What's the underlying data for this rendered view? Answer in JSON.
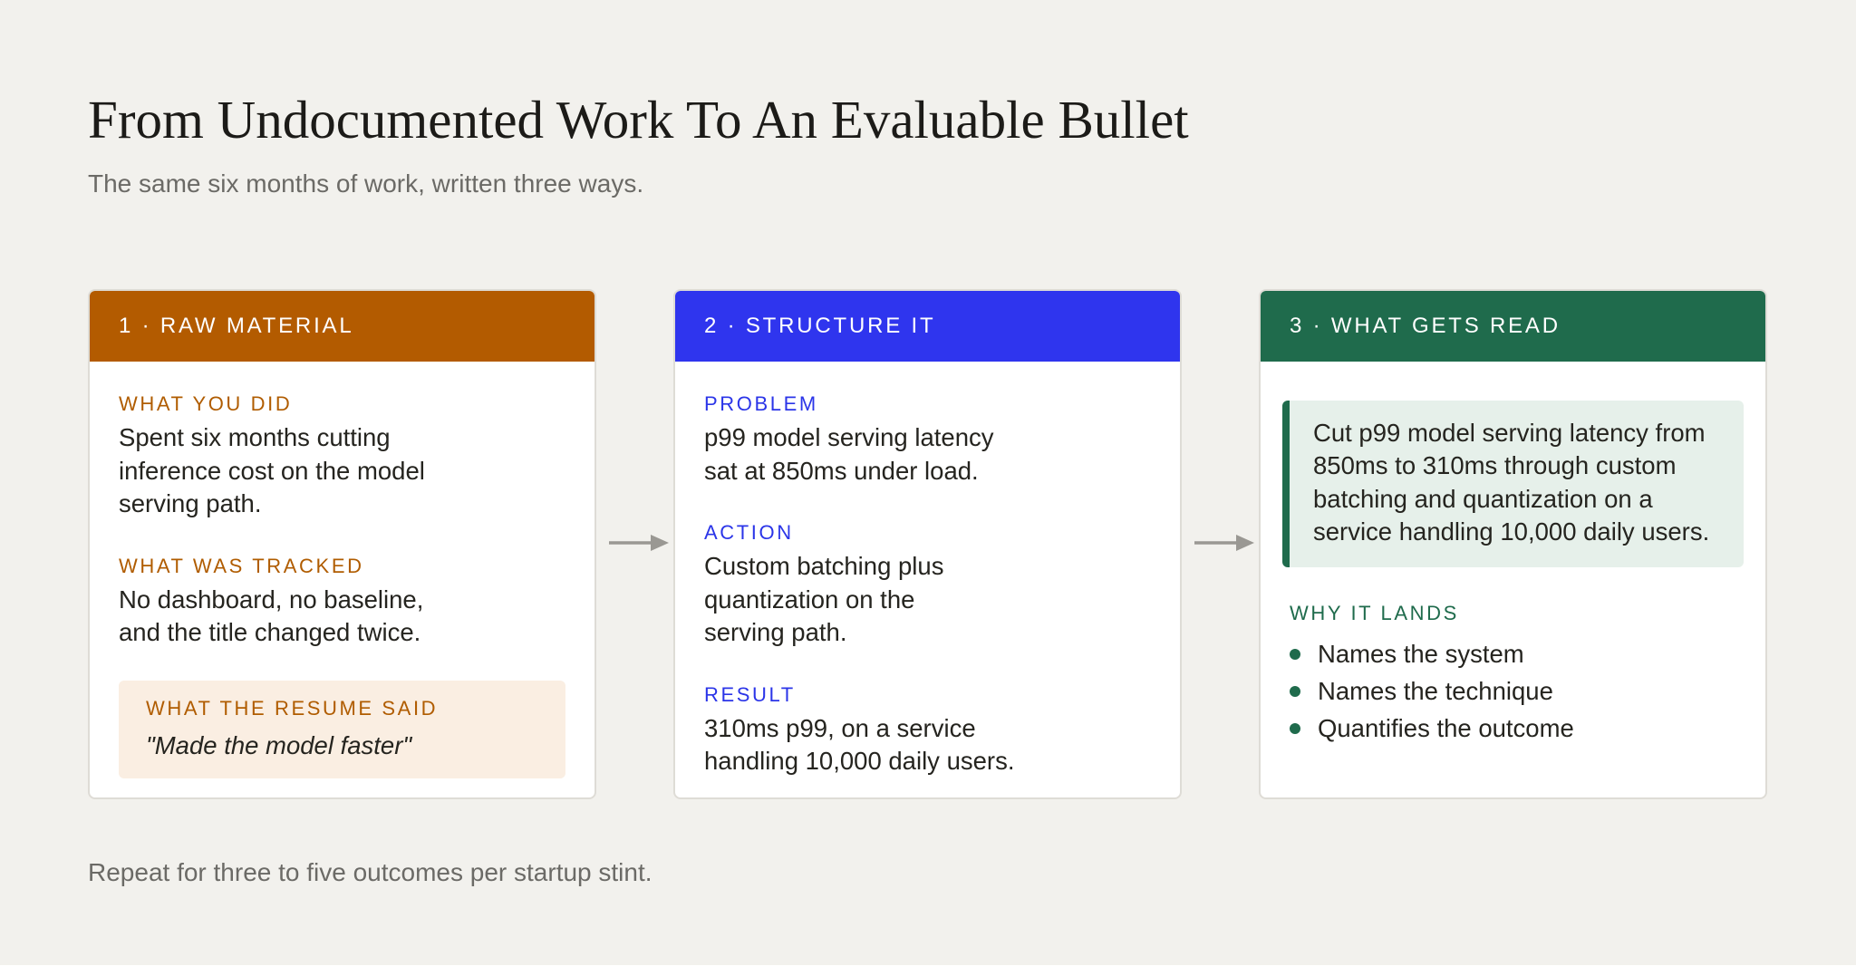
{
  "title": "From Undocumented Work To An Evaluable Bullet",
  "subtitle": "The same six months of work, written three ways.",
  "footer": "Repeat for three to five outcomes per startup stint.",
  "colors": {
    "background": "#f2f1ed",
    "raw": "#b35b00",
    "raw_tint": "#faeee2",
    "structure": "#2f35ee",
    "read": "#1f6b4c",
    "read_tint": "#e6f0ea",
    "arrow": "#9a9893"
  },
  "cards": {
    "raw": {
      "header": "1 · RAW MATERIAL",
      "sections": [
        {
          "label": "WHAT YOU DID",
          "text": "Spent six months cutting inference cost on the model serving path."
        },
        {
          "label": "WHAT WAS TRACKED",
          "text": "No dashboard, no baseline, and the title changed twice."
        }
      ],
      "quote": {
        "label": "WHAT THE RESUME SAID",
        "text": "\"Made the model faster\""
      }
    },
    "structure": {
      "header": "2 · STRUCTURE IT",
      "sections": [
        {
          "label": "PROBLEM",
          "text": "p99 model serving latency sat at 850ms under load."
        },
        {
          "label": "ACTION",
          "text": "Custom batching plus quantization on the serving path."
        },
        {
          "label": "RESULT",
          "text": "310ms p99, on a service handling 10,000 daily users."
        }
      ]
    },
    "read": {
      "header": "3 · WHAT GETS READ",
      "bullet_text": "Cut p99 model serving latency from 850ms to 310ms through custom batching and quantization on a service handling 10,000 daily users.",
      "why_label": "WHY IT LANDS",
      "reasons": [
        "Names the system",
        "Names the technique",
        "Quantifies the outcome"
      ]
    }
  },
  "arrows": {
    "icon": "right-arrow-icon"
  }
}
